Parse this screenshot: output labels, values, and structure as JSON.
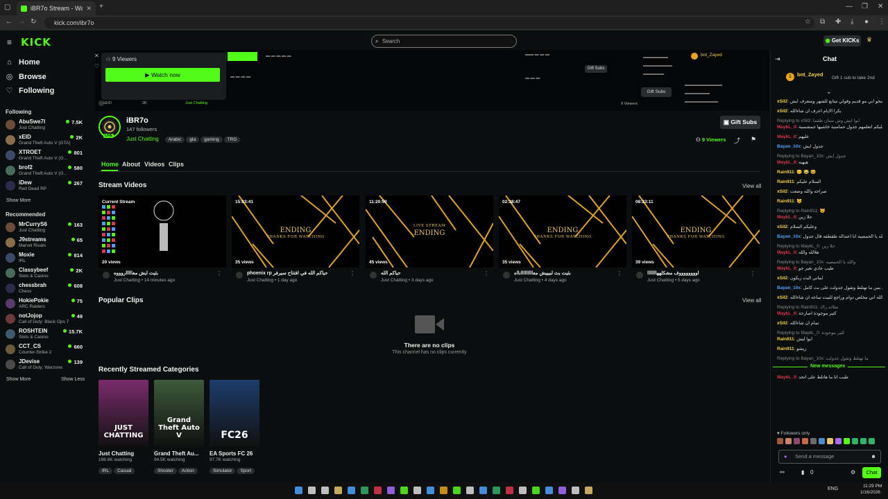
{
  "browser": {
    "tab_title": "iBR7o Stream - Watch Live on K",
    "url": "kick.com/ibr7o"
  },
  "brand": {
    "logo": "KICK",
    "accent": "#53fc18"
  },
  "sidebar": {
    "nav": [
      {
        "label": "Home",
        "icon": "home-icon"
      },
      {
        "label": "Browse",
        "icon": "compass-icon"
      },
      {
        "label": "Following",
        "icon": "heart-icon"
      }
    ],
    "following_title": "Following",
    "following": [
      {
        "name": "AbuSwe7l",
        "game": "Just Chatting",
        "viewers": "7.5K"
      },
      {
        "name": "xEID",
        "game": "Grand Theft Auto V (GTA)",
        "viewers": "2K"
      },
      {
        "name": "XTROET",
        "game": "Grand Theft Auto V (G...",
        "viewers": "801"
      },
      {
        "name": "brof2",
        "game": "Grand Theft Auto V (G...",
        "viewers": "580"
      },
      {
        "name": "iDew",
        "game": "Red Dead RP",
        "viewers": "267"
      }
    ],
    "show_more": "Show More",
    "recommended_title": "Recommended",
    "recommended": [
      {
        "name": "MrCurryS6",
        "game": "Just Chatting",
        "viewers": "163"
      },
      {
        "name": "J9streams",
        "game": "Marvel Rivals",
        "viewers": "65"
      },
      {
        "name": "Moxie",
        "game": "IRL",
        "viewers": "814"
      },
      {
        "name": "Classybeef",
        "game": "Slots & Casino",
        "viewers": "2K"
      },
      {
        "name": "chessbrah",
        "game": "Chess",
        "viewers": "608"
      },
      {
        "name": "HokiePokie",
        "game": "ARC Raiders",
        "viewers": "75"
      },
      {
        "name": "notJojop",
        "game": "Call of Duty: Black Ops 7",
        "viewers": "49"
      },
      {
        "name": "ROSHTEIN",
        "game": "Slots & Casino",
        "viewers": "15.7K"
      },
      {
        "name": "CCT_CS",
        "game": "Counter-Strike 2",
        "viewers": "660"
      },
      {
        "name": "JDevise",
        "game": "Call of Duty: Warzone",
        "viewers": "139"
      }
    ],
    "show_more_2": "Show More",
    "show_less": "Show Less"
  },
  "header": {
    "search_placeholder": "Search",
    "get_kicks": "Get KICKs"
  },
  "hero": {
    "viewers": "9 Viewers",
    "watch_now": "Watch now",
    "gift_subs": "Gift Subs",
    "mini_name": "xEID",
    "mini_viewers": "2K",
    "mini_category": "Just Chatting"
  },
  "channel": {
    "name": "iBR7o",
    "followers": "147 followers",
    "category": "Just Chatting",
    "tags": [
      "Arabic",
      "gta",
      "gaming",
      "TRG"
    ],
    "live_badge": "LIVE",
    "gift_subs": "Gift Subs",
    "viewers": "9 Viewers"
  },
  "tabs": [
    "Home",
    "About",
    "Videos",
    "Clips"
  ],
  "stream_videos": {
    "title": "Stream Videos",
    "view_all": "View all",
    "items": [
      {
        "badge": "Current Stream",
        "views": "20 views",
        "title": "بثيت ايش معاااااروووه",
        "meta": "Just Chatting • 14 minutes ago",
        "kind": "current"
      },
      {
        "badge": "15:03:41",
        "views": "35 views",
        "title": "phoenix rp حياكم الله في افتتاح سيرفر",
        "meta": "Just Chatting • 1 day ago",
        "kind": "ending"
      },
      {
        "badge": "11:20:50",
        "views": "45 views",
        "title": "حياكم الله",
        "meta": "Just Chatting • 3 days ago",
        "kind": "live"
      },
      {
        "badge": "02:38:47",
        "views": "35 views",
        "title": "بثيت بث لبيييش معااااااااانااه",
        "meta": "Just Chatting • 4 days ago",
        "kind": "ending2"
      },
      {
        "badge": "08:23:11",
        "views": "39 views",
        "title": "اووووووووف مشكلههااااااا",
        "meta": "Just Chatting • 5 days ago",
        "kind": "ending"
      }
    ],
    "ending_text": "ENDING",
    "ending_sub": "THANKS FOR WATCHING",
    "live_sub": "LIVE STREAM"
  },
  "clips": {
    "title": "Popular Clips",
    "view_all": "View all",
    "empty_title": "There are no clips",
    "empty_sub": "This channel has no clips currently"
  },
  "categories": {
    "title": "Recently Streamed Categories",
    "items": [
      {
        "name": "Just Chatting",
        "watching": "198.8K watching",
        "tags": [
          "IRL",
          "Casual"
        ],
        "art": "JUST CHATTING",
        "color": "#7a2b6e"
      },
      {
        "name": "Grand Theft Au...",
        "watching": "94.5K watching",
        "tags": [
          "Shooter",
          "Action"
        ],
        "art": "Grand Theft Auto V",
        "color": "#3d5a3a"
      },
      {
        "name": "EA Sports FC 26",
        "watching": "97.7K watching",
        "tags": [
          "Simulator",
          "Sport"
        ],
        "art": "FC26",
        "color": "#1c3d6b"
      }
    ]
  },
  "chat": {
    "title": "Chat",
    "top_user": "bnt_Zayed",
    "top_note": "Gift 1 sub to take 2nd",
    "new_messages": "New messages",
    "followers_only": "Followers only",
    "input_placeholder": "Send a message",
    "send_button": "Chat",
    "kicks_count": "0",
    "messages": [
      {
        "user": "xSil2",
        "c": "y",
        "text": "شخو اني مو قديم وقولي متابع للشهر ومتعرف ايش"
      },
      {
        "user": "xSil2",
        "c": "y",
        "text": "بكرا الايام اعرف ان شاءالله"
      },
      {
        "reply": "Replying to xSil2: ايوا ايش وش سنان طقما"
      },
      {
        "user": "MaykL_0",
        "c": "r",
        "text": "بحساس فحتت الجان عليكم اتعلمهم جدول حماسية خاشيها جمشسية"
      },
      {
        "user": "MaykL_0",
        "c": "r",
        "text": "عليهم"
      },
      {
        "user": "Bayan_10x",
        "c": "b",
        "text": "جدول ايش"
      },
      {
        "reply": "Replying to Bayan_10x: جدول ايش"
      },
      {
        "user": "MaykL_0",
        "c": "r",
        "text": "هيهيه"
      },
      {
        "user": "Rain911",
        "c": "y",
        "text": "😊 😂 😆"
      },
      {
        "user": "Rain911",
        "c": "y",
        "text": "السلام عليكم"
      },
      {
        "user": "xSil2",
        "c": "y",
        "text": "صراحه والله وضعت"
      },
      {
        "user": "Rain911",
        "c": "y",
        "text": "😺"
      },
      {
        "reply": "Replying to Rain911: 😺"
      },
      {
        "user": "MaykL_0",
        "c": "r",
        "text": "حلا زين"
      },
      {
        "user": "xSil2",
        "c": "y",
        "text": "وعليكم السلام"
      },
      {
        "user": "Bayan_10x",
        "c": "b",
        "text": "والله يا الحمصيه انا اعتذاله طقطقه قال جدول"
      },
      {
        "reply": "Replying to MaykL_0: حلا زين"
      },
      {
        "user": "MaykL_0",
        "c": "r",
        "text": "هلالله والله"
      },
      {
        "reply": "Replying to Bayan_10x: والله يا الحمصيه"
      },
      {
        "user": "MaykL_0",
        "c": "r",
        "text": "طيب عادي نغير جو"
      },
      {
        "user": "xSil2",
        "c": "y",
        "text": "لماني البث زيكون"
      },
      {
        "user": "Bayan_10x",
        "c": "b",
        "text": "اي بس ما تهتلط وتقول جدولت على بث كامل"
      },
      {
        "user": "xSil2",
        "c": "y",
        "text": "عشان والله اني مخلص دوام وراجع للبيت ساعه ان شاءالله"
      },
      {
        "reply": "Replying to Rain911: مثلاثه راك"
      },
      {
        "user": "MaykL_0",
        "c": "r",
        "text": "كثير موجودة اصارحة"
      },
      {
        "user": "xSil2",
        "c": "y",
        "text": "تمام ان شاءالله"
      },
      {
        "reply": "Replying to MaykL_0: كثير موجودة"
      },
      {
        "user": "Rain911",
        "c": "y",
        "text": "ايوا ليش"
      },
      {
        "user": "Rain911",
        "c": "y",
        "text": "ريشو"
      },
      {
        "reply": "Replying to Bayan_10x: ما تهتلط وتقول جدولت"
      },
      {
        "user": "MaykL_0",
        "c": "r",
        "text": "طيب انا ما هاتلط على اتحد"
      }
    ]
  },
  "taskbar": {
    "language": "ENG",
    "time": "11:29 PM",
    "date": "1/16/2026"
  }
}
